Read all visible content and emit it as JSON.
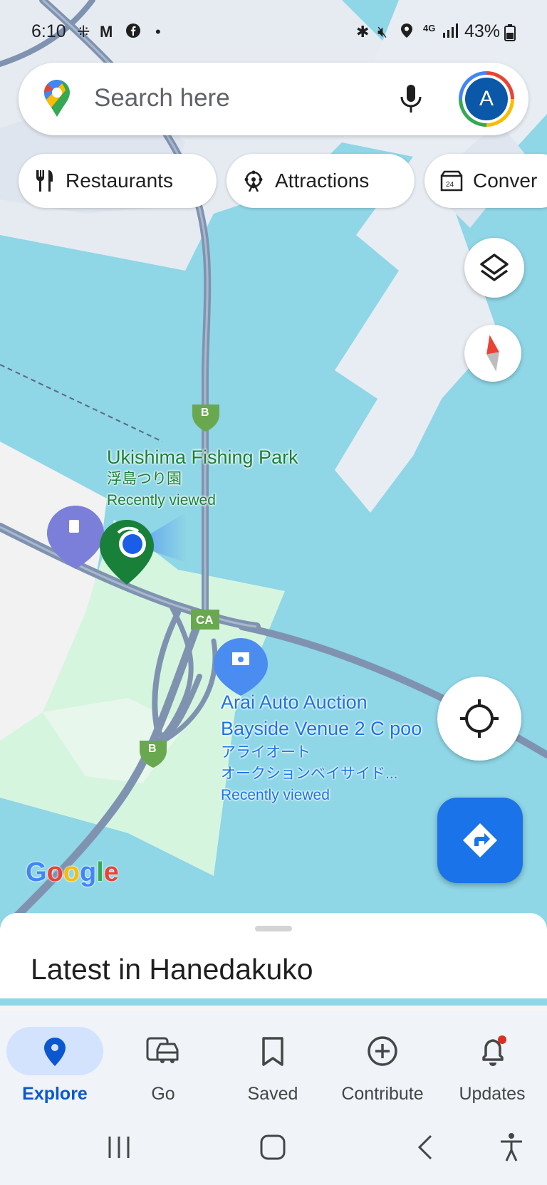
{
  "status_bar": {
    "time": "6:10",
    "network": "4G",
    "battery": "43%"
  },
  "search": {
    "placeholder": "Search here",
    "avatar_letter": "A"
  },
  "chips": [
    {
      "icon": "fork-knife-icon",
      "label": "Restaurants"
    },
    {
      "icon": "ferris-wheel-icon",
      "label": "Attractions"
    },
    {
      "icon": "store-24h-icon",
      "label": "Conver"
    }
  ],
  "map": {
    "road_shields": [
      "B",
      "CA",
      "B"
    ],
    "places": [
      {
        "name": "Ukishima Fishing Park",
        "name_ja": "浮島つり園",
        "note": "Recently viewed",
        "color": "#188038"
      },
      {
        "name_line1": "Arai Auto Auction",
        "name_line2": "Bayside Venue 2 C poo",
        "name_ja_line1": "アライオート",
        "name_ja_line2": "オークションベイサイド...",
        "note": "Recently viewed",
        "color": "#1a73e8"
      }
    ],
    "logo": "Google",
    "colors": {
      "water": "#8fd6e6",
      "land": "#f2f2f2",
      "park": "#d6f5df",
      "road": "#7f93b0",
      "highway_shield": "#6aa84f"
    }
  },
  "sheet": {
    "title": "Latest in Hanedakuko"
  },
  "bottom_nav": [
    {
      "label": "Explore",
      "icon": "pin-icon",
      "active": true
    },
    {
      "label": "Go",
      "icon": "car-icon"
    },
    {
      "label": "Saved",
      "icon": "bookmark-icon"
    },
    {
      "label": "Contribute",
      "icon": "plus-circle-icon"
    },
    {
      "label": "Updates",
      "icon": "bell-icon",
      "badge": true
    }
  ],
  "accent_color": "#1a73e8"
}
